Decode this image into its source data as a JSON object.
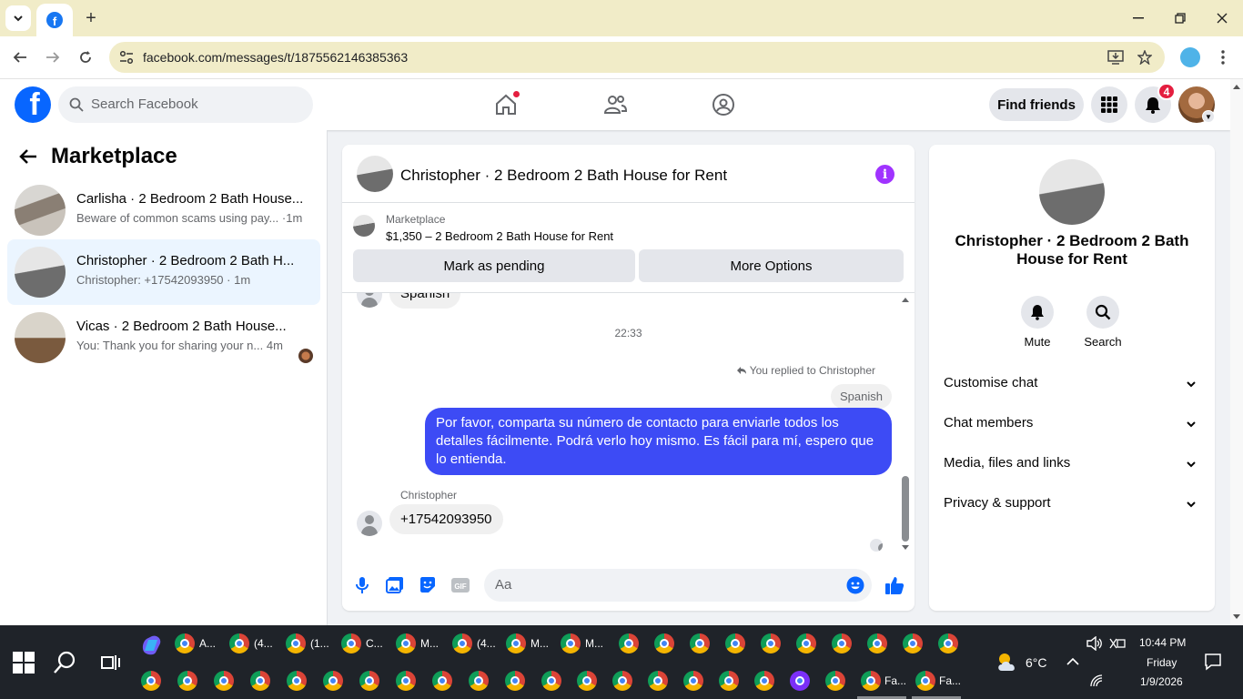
{
  "browser": {
    "url": "facebook.com/messages/t/1875562146385363"
  },
  "fb_header": {
    "search_placeholder": "Search Facebook",
    "find_friends": "Find friends",
    "notification_count": "4"
  },
  "left": {
    "title": "Marketplace",
    "conversations": [
      {
        "name": "Carlisha · 2 Bedroom 2 Bath House...",
        "preview": "Beware of common scams using pay... ·1m"
      },
      {
        "name": "Christopher · 2 Bedroom 2 Bath H...",
        "preview": "Christopher: +17542093950 · 1m"
      },
      {
        "name": "Vicas · 2 Bedroom 2 Bath House...",
        "preview": "You: Thank you for sharing your n...   4m"
      }
    ]
  },
  "chat": {
    "title": "Christopher · 2 Bedroom 2 Bath House for Rent",
    "marketplace_label": "Marketplace",
    "listing": "$1,350 – 2 Bedroom 2 Bath House for Rent",
    "mark_pending": "Mark as pending",
    "more_options": "More Options",
    "prev_bubble": "Spanish",
    "timestamp": "22:33",
    "replied_note": "You replied to Christopher",
    "quoted": "Spanish",
    "my_message": "Por favor, comparta su número de contacto para enviarle todos los detalles fácilmente. Podrá verlo hoy mismo. Es fácil para mí, espero que lo entienda.",
    "sender": "Christopher",
    "their_message": "+17542093950",
    "composer_placeholder": "Aa"
  },
  "info": {
    "name": "Christopher · 2 Bedroom 2 Bath House for Rent",
    "mute": "Mute",
    "search": "Search",
    "sections": [
      "Customise chat",
      "Chat members",
      "Media, files and links",
      "Privacy & support"
    ]
  },
  "taskbar": {
    "labels_row1": [
      "A...",
      "(4...",
      "(1...",
      "C...",
      "M...",
      "(4...",
      "M...",
      "M..."
    ],
    "labels_row2": [
      "Fa...",
      "Fa..."
    ],
    "weather": "6°C",
    "time": "10:44 PM",
    "day": "Friday",
    "date": "1/9/2026"
  },
  "colors": {
    "fb_blue": "#0866ff",
    "my_bubble": "#3d4bf5",
    "info_purple": "#a033ff",
    "badge_red": "#e41e3f"
  }
}
